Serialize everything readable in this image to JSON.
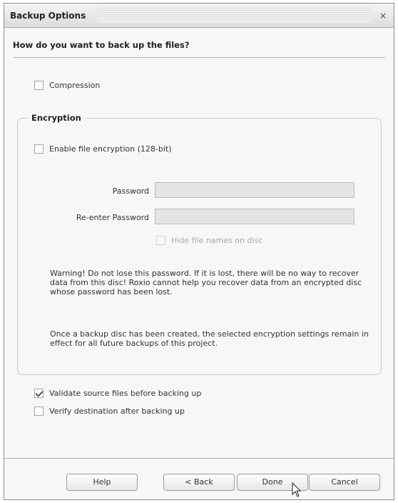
{
  "window": {
    "title": "Backup Options",
    "close_label": "×"
  },
  "heading": "How do you want to back up the files?",
  "compression": {
    "label": "Compression",
    "checked": false
  },
  "encryption": {
    "group_label": "Encryption",
    "enable_label": "Enable file encryption (128-bit)",
    "enable_checked": false,
    "password_label": "Password",
    "password_value": "",
    "reenter_label": "Re-enter Password",
    "reenter_value": "",
    "hide_names_label": "Hide file names on disc",
    "hide_names_checked": false,
    "warning_text": "Warning! Do not lose this password. If it is lost, there will be no way to recover data from this disc! Roxio cannot help you recover data from an encrypted disc whose password has been lost.",
    "note_text": "Once a backup disc has been created, the selected encryption settings remain in effect for all future backups of this project."
  },
  "validate": {
    "label": "Validate source files before backing up",
    "checked": true
  },
  "verify": {
    "label": "Verify destination after backing up",
    "checked": false
  },
  "buttons": {
    "help": "Help",
    "back": "< Back",
    "done": "Done",
    "cancel": "Cancel"
  },
  "icons": {
    "close": "close-icon",
    "cursor": "mouse-pointer-icon",
    "check": "checkmark-icon"
  }
}
